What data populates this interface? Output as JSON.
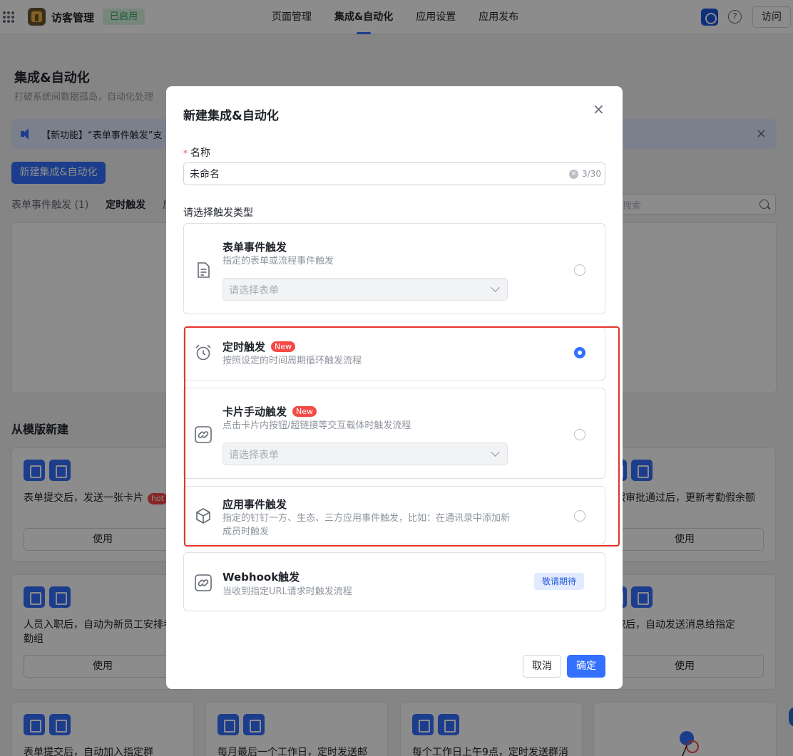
{
  "topbar": {
    "app_name": "访客管理",
    "status": "已启用",
    "nav": [
      "页面管理",
      "集成&自动化",
      "应用设置",
      "应用发布"
    ],
    "active_nav": "集成&自动化",
    "visit_label": "访问",
    "help_label": "?"
  },
  "page": {
    "title": "集成&自动化",
    "desc": "打破系统间数据孤岛，自动化处理",
    "notice": "【新功能】“表单事件触发”支",
    "new_button": "新建集成&自动化",
    "filters": [
      "表单事件触发 (1)",
      "定时触发",
      "应"
    ],
    "search_placeholder": "搜索",
    "section_title": "从模版新建",
    "use_label": "使用",
    "templates": [
      {
        "title": "表单提交后，发送一张卡片",
        "tag": "hot"
      },
      {
        "title": "请假审批通过后，更新考勤假余额",
        "tag": ""
      },
      {
        "title": "人员入职后，自动为新员工安排考勤组",
        "tag": ""
      },
      {
        "title": "离职后，自动发送消息给指定",
        "tag": ""
      },
      {
        "title": "表单提交后，自动加入指定群",
        "tag": ""
      },
      {
        "title": "每月最后一个工作日，定时发送邮",
        "tag": ""
      },
      {
        "title": "每个工作日上午9点，定时发送群消",
        "tag": ""
      }
    ]
  },
  "modal": {
    "title": "新建集成&自动化",
    "close": "×",
    "name_label": "名称",
    "required_mark": "*",
    "name_value": "未命名",
    "name_counter": "3/30",
    "trigger_label": "请选择触发类型",
    "options": [
      {
        "title": "表单事件触发",
        "desc": "指定的表单或流程事件触发",
        "select_placeholder": "请选择表单",
        "new": false,
        "selected": false,
        "icon": "document-icon"
      },
      {
        "title": "定时触发",
        "desc": "按照设定的时间周期循环触发流程",
        "new": true,
        "selected": true,
        "icon": "alarm-clock-icon"
      },
      {
        "title": "卡片手动触发",
        "desc": "点击卡片内按钮/超链接等交互载体时触发流程",
        "select_placeholder": "请选择表单",
        "new": true,
        "selected": false,
        "icon": "link-icon"
      },
      {
        "title": "应用事件触发",
        "desc": "指定的钉钉一方、生态、三方应用事件触发，比如：在通讯录中添加新成员时触发",
        "new": false,
        "selected": false,
        "icon": "cube-icon"
      },
      {
        "title": "Webhook触发",
        "desc": "当收到指定URL请求时触发流程",
        "soon": "敬请期待",
        "new": false,
        "selected": false,
        "icon": "link-icon"
      }
    ],
    "new_badge": "New",
    "cancel": "取消",
    "ok": "确定"
  }
}
